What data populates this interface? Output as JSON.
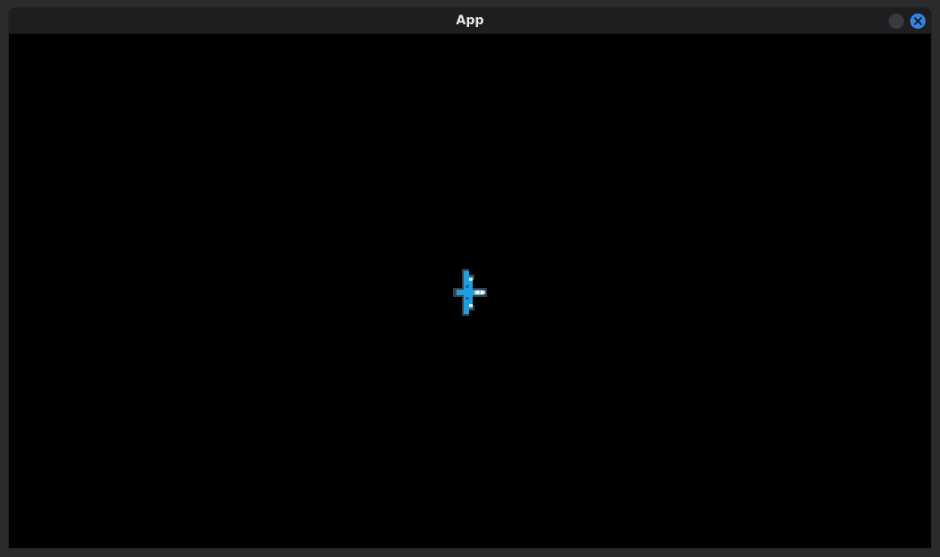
{
  "window": {
    "title": "App",
    "controls": {
      "minimize_icon": "minimize-icon",
      "close_icon": "close-icon",
      "close_color": "#3584e4"
    }
  },
  "game": {
    "background_color": "#000000",
    "player": {
      "sprite": "airplane-icon",
      "color": "#1ea0e0"
    }
  }
}
